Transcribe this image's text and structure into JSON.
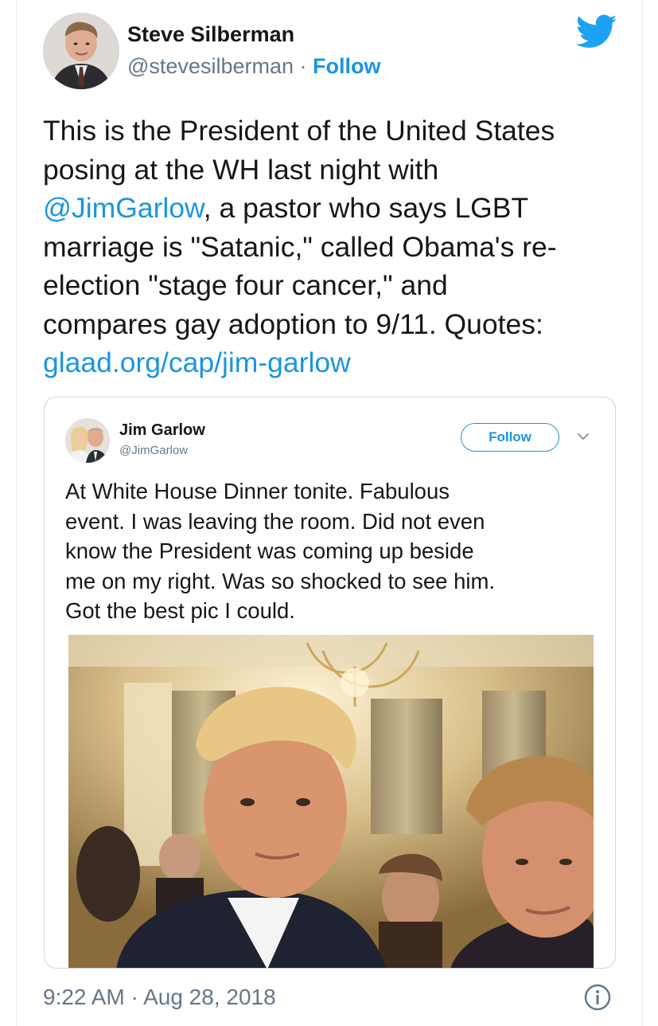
{
  "tweet": {
    "author": {
      "name": "Steve Silberman",
      "handle": "@stevesilberman",
      "separator": "·",
      "follow_label": "Follow"
    },
    "text_lines": [
      "This is the President of the United States",
      "posing at the WH last night with",
      ", a pastor who says LGBT",
      "marriage is \"Satanic,\" called Obama's re-",
      "election \"stage four cancer,\" and",
      "compares gay adoption to 9/11. Quotes:"
    ],
    "mention": "@JimGarlow",
    "link": "glaad.org/cap/jim-garlow",
    "quoted": {
      "name": "Jim Garlow",
      "handle": "@JimGarlow",
      "follow_label": "Follow",
      "text_lines": [
        "At White House Dinner tonite. Fabulous",
        "event. I was leaving the room. Did not even",
        "know the President was coming up beside",
        "me on my right. Was so shocked to see him.",
        "Got the best pic I could."
      ]
    },
    "timestamp": "9:22 AM · Aug 28, 2018"
  },
  "icons": {
    "brand": "twitter-bird-icon",
    "menu": "chevron-down-icon",
    "info": "info-icon"
  },
  "colors": {
    "link": "#1b95e0",
    "secondary": "#657786",
    "text": "#14171a",
    "border": "#e1e8ed"
  }
}
